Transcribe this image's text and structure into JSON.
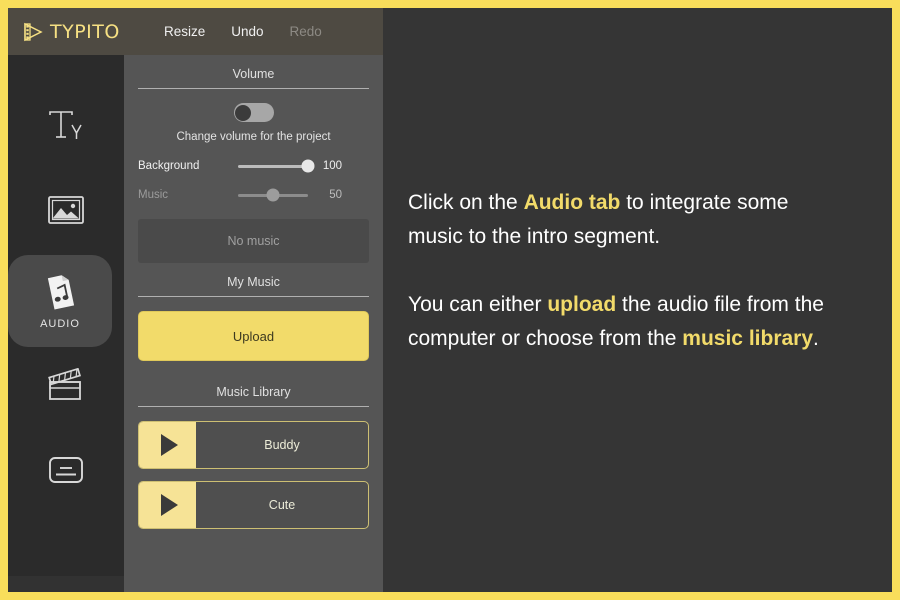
{
  "theme": {
    "frame_color": "#F9DE5B",
    "accent": "#F2DB6A",
    "panel_bg": "#555555",
    "rail_bg": "#2b2b2b",
    "stage_bg": "#353535"
  },
  "brand": {
    "name": "TYPITO",
    "logo_icon": "film-play-logo-icon"
  },
  "toolbar": {
    "resize_label": "Resize",
    "undo_label": "Undo",
    "redo_label": "Redo"
  },
  "rail": {
    "items": [
      {
        "label": "",
        "icon": "text-ty-icon",
        "name": "text",
        "active": false
      },
      {
        "label": "",
        "icon": "image-icon",
        "name": "image",
        "active": false
      },
      {
        "label": "AUDIO",
        "icon": "audio-file-note-icon",
        "name": "audio",
        "active": true
      },
      {
        "label": "",
        "icon": "clapperboard-icon",
        "name": "video",
        "active": false
      },
      {
        "label": "",
        "icon": "subtitle-card-icon",
        "name": "subtitle",
        "active": false
      }
    ]
  },
  "volume": {
    "section_title": "Volume",
    "toggle_caption": "Change volume for the project",
    "toggle_on": false,
    "sliders": [
      {
        "label": "Background",
        "value": "100",
        "percent": 100,
        "enabled": true
      },
      {
        "label": "Music",
        "value": "50",
        "percent": 50,
        "enabled": false
      }
    ],
    "no_music_label": "No music"
  },
  "my_music": {
    "section_title": "My Music",
    "upload_label": "Upload"
  },
  "music_library": {
    "section_title": "Music Library",
    "tracks": [
      {
        "name": "Buddy",
        "play_icon": "play-triangle-icon"
      },
      {
        "name": "Cute",
        "play_icon": "play-triangle-icon"
      }
    ]
  },
  "instructions": {
    "p1_a": "Click on the ",
    "p1_hl": "Audio tab",
    "p1_b": " to integrate some music to the intro segment.",
    "p2_a": "You can either ",
    "p2_hl1": "upload",
    "p2_b": " the audio file from the computer or choose from the ",
    "p2_hl2": "music library",
    "p2_c": "."
  }
}
